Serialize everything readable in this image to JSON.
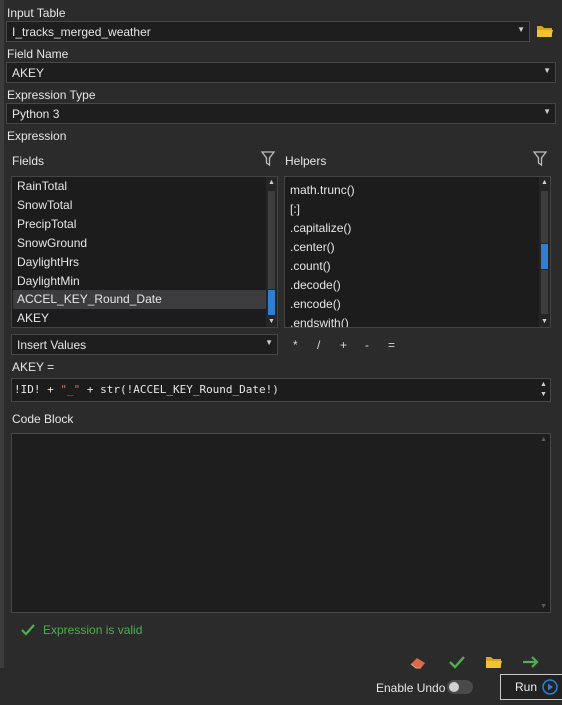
{
  "input_table": {
    "label": "Input Table",
    "value": "I_tracks_merged_weather"
  },
  "field_name": {
    "label": "Field Name",
    "value": "AKEY"
  },
  "expression_type": {
    "label": "Expression Type",
    "value": "Python 3"
  },
  "expression": {
    "label": "Expression",
    "fields_title": "Fields",
    "helpers_title": "Helpers",
    "fields": [
      "RainTotal",
      "SnowTotal",
      "PrecipTotal",
      "SnowGround",
      "DaylightHrs",
      "DaylightMin",
      "ACCEL_KEY_Round_Date",
      "AKEY"
    ],
    "selected_field": "ACCEL_KEY_Round_Date",
    "helpers": [
      "math.trunc()",
      "[:]",
      ".capitalize()",
      ".center()",
      ".count()",
      ".decode()",
      ".encode()",
      ".endswith()"
    ],
    "insert_values": "Insert Values",
    "operators": [
      "*",
      "/",
      "+",
      "-",
      "="
    ],
    "target_label": "AKEY =",
    "code": {
      "part1": "!ID! + ",
      "part2": "\"_\"",
      "part3": " + str(!ACCEL_KEY_Round_Date!)"
    },
    "code_block_label": "Code Block",
    "code_block_value": ""
  },
  "validation": {
    "text": "Expression is valid",
    "color": "#4bb14b"
  },
  "footer": {
    "enable_undo_label": "Enable Undo",
    "enable_undo_on": false,
    "run_label": "Run"
  },
  "icons": [
    "folder-icon",
    "filter-icon",
    "eraser-icon",
    "check-icon",
    "open-folder-icon",
    "arrow-right-icon",
    "play-icon"
  ],
  "colors": {
    "accent": "#2e7fd1",
    "valid": "#4bb14b",
    "string": "#e06c4e"
  }
}
